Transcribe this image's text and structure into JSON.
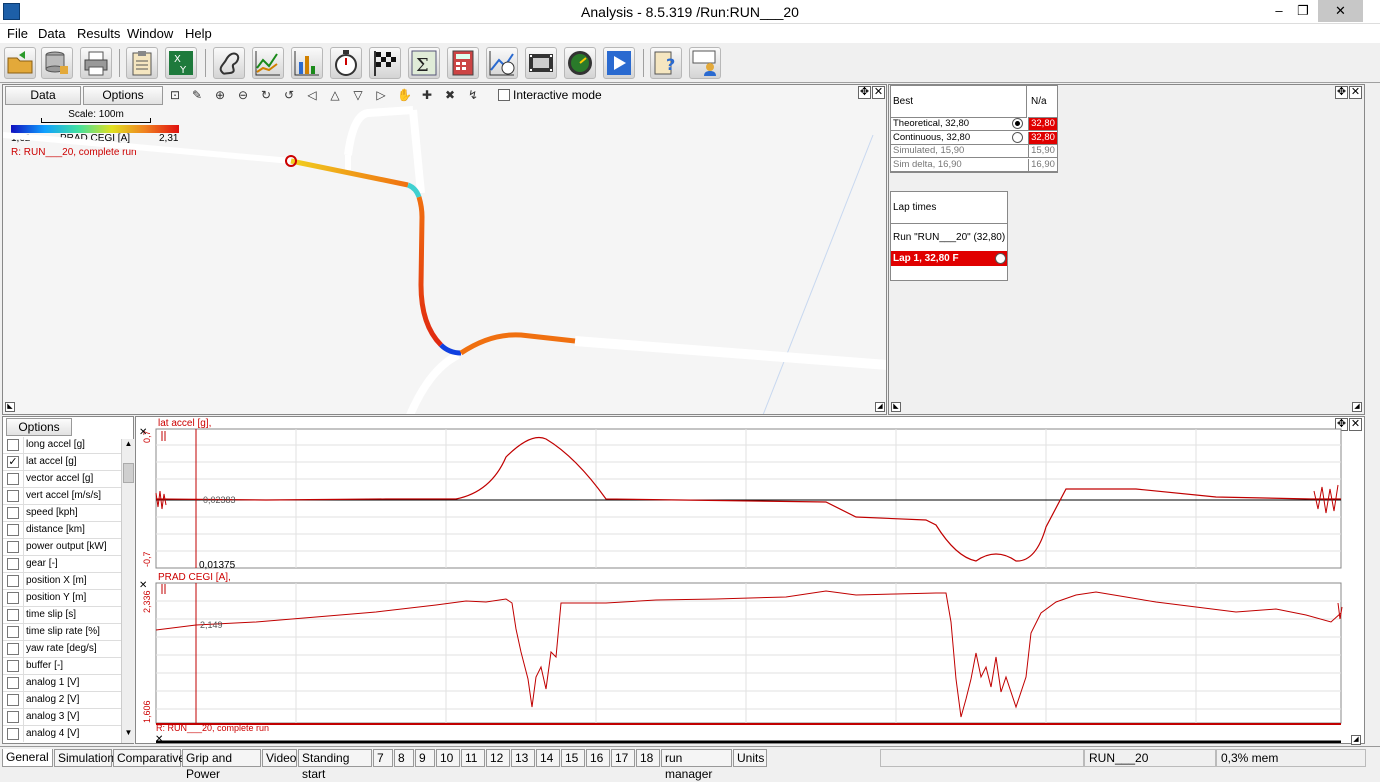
{
  "window": {
    "title": "Analysis - 8.5.319 /Run:RUN___20",
    "controls": [
      "–",
      "❐",
      "✕"
    ]
  },
  "menu": [
    "File",
    "Data",
    "Results",
    "Window",
    "Help"
  ],
  "toolbar": [
    "open-icon",
    "database-icon",
    "printer-icon",
    "clipboard-icon",
    "xy-export-icon",
    "track-map-icon",
    "line-graph-icon",
    "bar-chart-icon",
    "stopwatch-icon",
    "checkered-flag-icon",
    "sigma-sum-icon",
    "calculator-icon",
    "graph-clock-icon",
    "video-film-icon",
    "speedometer-icon",
    "play-icon",
    "help-icon",
    "chat-user-icon"
  ],
  "map": {
    "data_button": "Data",
    "options_button": "Options",
    "interactive_mode": "Interactive mode",
    "scale": "Scale: 100m",
    "legend_min": "1,62",
    "legend_label": "PRAD CEGI [A]",
    "legend_max": "2,31",
    "run_label": "R:  RUN___20, complete run"
  },
  "best": {
    "header": "Best",
    "na": "N/a",
    "rows": [
      {
        "label": "Theoretical,  32,80",
        "value": "32,80",
        "highlight": true,
        "radio": "checked"
      },
      {
        "label": "Continuous, 32,80",
        "value": "32,80",
        "highlight": true,
        "radio": "unchecked"
      },
      {
        "label": "Simulated, 15,90",
        "value": "15,90",
        "highlight": false
      },
      {
        "label": "Sim delta, 16,90",
        "value": "16,90",
        "highlight": false
      }
    ]
  },
  "laptimes": {
    "header": "Lap times",
    "run": "Run \"RUN___20\" (32,80)",
    "lap": "Lap 1, 32,80 F"
  },
  "signals": {
    "options_button": "Options",
    "items": [
      {
        "label": "long accel [g]",
        "checked": false
      },
      {
        "label": "lat accel [g]",
        "checked": true
      },
      {
        "label": "vector accel [g]",
        "checked": false
      },
      {
        "label": "vert accel [m/s/s]",
        "checked": false
      },
      {
        "label": "speed [kph]",
        "checked": false
      },
      {
        "label": "distance [km]",
        "checked": false
      },
      {
        "label": "power output [kW]",
        "checked": false
      },
      {
        "label": "gear [-]",
        "checked": false
      },
      {
        "label": "position X [m]",
        "checked": false
      },
      {
        "label": "position Y [m]",
        "checked": false
      },
      {
        "label": "time slip [s]",
        "checked": false
      },
      {
        "label": "time slip rate [%]",
        "checked": false
      },
      {
        "label": "yaw rate [deg/s]",
        "checked": false
      },
      {
        "label": "buffer [-]",
        "checked": false
      },
      {
        "label": "analog 1 [V]",
        "checked": false
      },
      {
        "label": "analog 2 [V]",
        "checked": false
      },
      {
        "label": "analog 3 [V]",
        "checked": false
      },
      {
        "label": "analog 4 [V]",
        "checked": false
      }
    ]
  },
  "graph1": {
    "title": "lat accel [g],",
    "ymax": "0,7",
    "ymin": "-0,7",
    "cursor_value": "-0,02383",
    "cursor_x": "0,01375"
  },
  "graph2": {
    "title": "PRAD CEGI [A],",
    "ymax": "2,336",
    "ymin": "1,606",
    "cursor_value": "2,149",
    "run_label": "R:  RUN___20, complete run"
  },
  "tabs": [
    "General",
    "Simulation",
    "Comparative",
    "Grip and Power",
    "Video",
    "Standing start",
    "7",
    "8",
    "9",
    "10",
    "11",
    "12",
    "13",
    "14",
    "15",
    "16",
    "17",
    "18",
    "run manager",
    "Units"
  ],
  "status": {
    "run": "RUN___20",
    "mem": "0,3% mem"
  },
  "colors": {
    "highlight": "#e00000",
    "trace": "#c00000"
  }
}
